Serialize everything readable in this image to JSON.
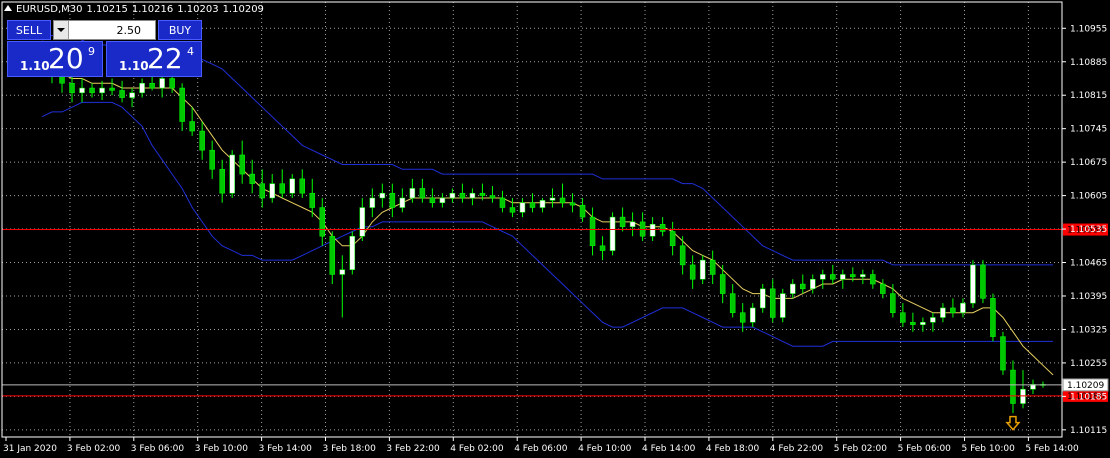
{
  "header": {
    "symbol": "EURUSD,M30",
    "open": "1.10215",
    "high": "1.10216",
    "low": "1.10203",
    "close": "1.10209"
  },
  "trade_panel": {
    "sell_label": "SELL",
    "buy_label": "BUY",
    "lot_value": "2.50",
    "sell_quote": {
      "prefix": "1.10",
      "big": "20",
      "pip": "9"
    },
    "buy_quote": {
      "prefix": "1.10",
      "big": "22",
      "pip": "4"
    }
  },
  "colors": {
    "background": "#000000",
    "grid": "#a0a0a0",
    "bull_candle": "#ffffff",
    "bear_candle": "#00c800",
    "wick": "#00ff00",
    "bollinger": "#1f2fd8",
    "moving_average": "#e8d060",
    "level_line": "#ff0000",
    "current_price_line": "#bbbbbb",
    "signal_arrow": "#e8a000"
  },
  "chart_data": {
    "type": "candlestick",
    "title": "",
    "y_ticks": [
      "1.10955",
      "1.10885",
      "1.10815",
      "1.10745",
      "1.10675",
      "1.10605",
      "1.10535",
      "1.10465",
      "1.10395",
      "1.10325",
      "1.10255",
      "1.10185",
      "1.10115"
    ],
    "x_ticks": [
      "31 Jan 2020",
      "3 Feb 02:00",
      "3 Feb 06:00",
      "3 Feb 10:00",
      "3 Feb 14:00",
      "3 Feb 18:00",
      "3 Feb 22:00",
      "4 Feb 02:00",
      "4 Feb 06:00",
      "4 Feb 10:00",
      "4 Feb 14:00",
      "4 Feb 18:00",
      "4 Feb 22:00",
      "5 Feb 02:00",
      "5 Feb 06:00",
      "5 Feb 10:00",
      "5 Feb 14:00"
    ],
    "ylim": [
      1.101,
      1.1101
    ],
    "horizontal_levels": [
      {
        "label": "1.10534",
        "value": 1.10534,
        "color": "#ff0000"
      },
      {
        "label": "1.10186",
        "value": 1.10186,
        "color": "#ff0000"
      },
      {
        "label": "1.10209",
        "value": 1.10209,
        "color": "#bbbbbb"
      }
    ],
    "candles": [
      {
        "o": 1.1089,
        "h": 1.109,
        "l": 1.1086,
        "c": 1.1088
      },
      {
        "o": 1.1088,
        "h": 1.1089,
        "l": 1.1084,
        "c": 1.1086
      },
      {
        "o": 1.1086,
        "h": 1.1088,
        "l": 1.1082,
        "c": 1.1084
      },
      {
        "o": 1.1084,
        "h": 1.1086,
        "l": 1.108,
        "c": 1.1082
      },
      {
        "o": 1.1082,
        "h": 1.1085,
        "l": 1.108,
        "c": 1.1083
      },
      {
        "o": 1.1083,
        "h": 1.1084,
        "l": 1.1081,
        "c": 1.1082
      },
      {
        "o": 1.1082,
        "h": 1.10845,
        "l": 1.10805,
        "c": 1.1083
      },
      {
        "o": 1.1083,
        "h": 1.1085,
        "l": 1.10815,
        "c": 1.10825
      },
      {
        "o": 1.10825,
        "h": 1.10845,
        "l": 1.108,
        "c": 1.1081
      },
      {
        "o": 1.1081,
        "h": 1.1083,
        "l": 1.1079,
        "c": 1.1082
      },
      {
        "o": 1.1082,
        "h": 1.1085,
        "l": 1.1081,
        "c": 1.1084
      },
      {
        "o": 1.1084,
        "h": 1.10855,
        "l": 1.10825,
        "c": 1.1083
      },
      {
        "o": 1.1083,
        "h": 1.1086,
        "l": 1.1081,
        "c": 1.1085
      },
      {
        "o": 1.1085,
        "h": 1.1086,
        "l": 1.1082,
        "c": 1.1083
      },
      {
        "o": 1.1083,
        "h": 1.1084,
        "l": 1.1074,
        "c": 1.1076
      },
      {
        "o": 1.1076,
        "h": 1.1079,
        "l": 1.1073,
        "c": 1.1074
      },
      {
        "o": 1.1074,
        "h": 1.1076,
        "l": 1.1068,
        "c": 1.107
      },
      {
        "o": 1.107,
        "h": 1.1072,
        "l": 1.1064,
        "c": 1.1066
      },
      {
        "o": 1.1066,
        "h": 1.1068,
        "l": 1.1059,
        "c": 1.1061
      },
      {
        "o": 1.1061,
        "h": 1.107,
        "l": 1.106,
        "c": 1.1069
      },
      {
        "o": 1.1069,
        "h": 1.1072,
        "l": 1.1063,
        "c": 1.1065
      },
      {
        "o": 1.1065,
        "h": 1.1068,
        "l": 1.1061,
        "c": 1.1063
      },
      {
        "o": 1.1063,
        "h": 1.1066,
        "l": 1.1058,
        "c": 1.106
      },
      {
        "o": 1.106,
        "h": 1.1065,
        "l": 1.1059,
        "c": 1.1063
      },
      {
        "o": 1.1063,
        "h": 1.1066,
        "l": 1.106,
        "c": 1.1061
      },
      {
        "o": 1.1061,
        "h": 1.1065,
        "l": 1.106,
        "c": 1.1064
      },
      {
        "o": 1.1064,
        "h": 1.1066,
        "l": 1.106,
        "c": 1.1061
      },
      {
        "o": 1.1061,
        "h": 1.1064,
        "l": 1.1056,
        "c": 1.1058
      },
      {
        "o": 1.1058,
        "h": 1.106,
        "l": 1.105,
        "c": 1.1052
      },
      {
        "o": 1.1052,
        "h": 1.1053,
        "l": 1.1042,
        "c": 1.1044
      },
      {
        "o": 1.1044,
        "h": 1.1048,
        "l": 1.1035,
        "c": 1.1045
      },
      {
        "o": 1.1045,
        "h": 1.1053,
        "l": 1.1044,
        "c": 1.1052
      },
      {
        "o": 1.1052,
        "h": 1.106,
        "l": 1.1051,
        "c": 1.1058
      },
      {
        "o": 1.1058,
        "h": 1.1062,
        "l": 1.1056,
        "c": 1.106
      },
      {
        "o": 1.106,
        "h": 1.1063,
        "l": 1.1058,
        "c": 1.1061
      },
      {
        "o": 1.1061,
        "h": 1.1063,
        "l": 1.1056,
        "c": 1.1058
      },
      {
        "o": 1.1058,
        "h": 1.1062,
        "l": 1.1057,
        "c": 1.106
      },
      {
        "o": 1.106,
        "h": 1.1064,
        "l": 1.1059,
        "c": 1.1062
      },
      {
        "o": 1.1062,
        "h": 1.1064,
        "l": 1.1059,
        "c": 1.106
      },
      {
        "o": 1.106,
        "h": 1.1062,
        "l": 1.1058,
        "c": 1.1059
      },
      {
        "o": 1.1059,
        "h": 1.1061,
        "l": 1.1058,
        "c": 1.106
      },
      {
        "o": 1.106,
        "h": 1.1062,
        "l": 1.1059,
        "c": 1.1061
      },
      {
        "o": 1.1061,
        "h": 1.1063,
        "l": 1.1059,
        "c": 1.106
      },
      {
        "o": 1.106,
        "h": 1.1062,
        "l": 1.10585,
        "c": 1.1061
      },
      {
        "o": 1.1061,
        "h": 1.1063,
        "l": 1.10595,
        "c": 1.10605
      },
      {
        "o": 1.10605,
        "h": 1.10625,
        "l": 1.1059,
        "c": 1.106
      },
      {
        "o": 1.106,
        "h": 1.10615,
        "l": 1.1057,
        "c": 1.1058
      },
      {
        "o": 1.1058,
        "h": 1.106,
        "l": 1.1056,
        "c": 1.1057
      },
      {
        "o": 1.1057,
        "h": 1.106,
        "l": 1.1056,
        "c": 1.1059
      },
      {
        "o": 1.1059,
        "h": 1.1061,
        "l": 1.1057,
        "c": 1.1058
      },
      {
        "o": 1.1058,
        "h": 1.106,
        "l": 1.1057,
        "c": 1.10595
      },
      {
        "o": 1.10595,
        "h": 1.1062,
        "l": 1.1058,
        "c": 1.106
      },
      {
        "o": 1.106,
        "h": 1.1063,
        "l": 1.1058,
        "c": 1.1059
      },
      {
        "o": 1.1059,
        "h": 1.1061,
        "l": 1.1057,
        "c": 1.10585
      },
      {
        "o": 1.10585,
        "h": 1.106,
        "l": 1.1055,
        "c": 1.1056
      },
      {
        "o": 1.1056,
        "h": 1.1058,
        "l": 1.1048,
        "c": 1.105
      },
      {
        "o": 1.105,
        "h": 1.1052,
        "l": 1.1047,
        "c": 1.1049
      },
      {
        "o": 1.1049,
        "h": 1.1057,
        "l": 1.1048,
        "c": 1.1056
      },
      {
        "o": 1.1056,
        "h": 1.1058,
        "l": 1.1053,
        "c": 1.1054
      },
      {
        "o": 1.1054,
        "h": 1.1057,
        "l": 1.1052,
        "c": 1.1055
      },
      {
        "o": 1.1055,
        "h": 1.1057,
        "l": 1.1051,
        "c": 1.1052
      },
      {
        "o": 1.1052,
        "h": 1.1056,
        "l": 1.1051,
        "c": 1.10545
      },
      {
        "o": 1.10545,
        "h": 1.1056,
        "l": 1.1052,
        "c": 1.1053
      },
      {
        "o": 1.1053,
        "h": 1.1055,
        "l": 1.1048,
        "c": 1.105
      },
      {
        "o": 1.105,
        "h": 1.1052,
        "l": 1.1044,
        "c": 1.1046
      },
      {
        "o": 1.1046,
        "h": 1.1048,
        "l": 1.1041,
        "c": 1.1043
      },
      {
        "o": 1.1043,
        "h": 1.1048,
        "l": 1.1042,
        "c": 1.1047
      },
      {
        "o": 1.1047,
        "h": 1.1049,
        "l": 1.1042,
        "c": 1.1044
      },
      {
        "o": 1.1044,
        "h": 1.1046,
        "l": 1.1038,
        "c": 1.104
      },
      {
        "o": 1.104,
        "h": 1.1042,
        "l": 1.1035,
        "c": 1.1036
      },
      {
        "o": 1.1036,
        "h": 1.1038,
        "l": 1.1032,
        "c": 1.1034
      },
      {
        "o": 1.1034,
        "h": 1.1038,
        "l": 1.1033,
        "c": 1.1037
      },
      {
        "o": 1.1037,
        "h": 1.1042,
        "l": 1.1036,
        "c": 1.1041
      },
      {
        "o": 1.1041,
        "h": 1.1043,
        "l": 1.1034,
        "c": 1.1035
      },
      {
        "o": 1.1035,
        "h": 1.1041,
        "l": 1.1034,
        "c": 1.104
      },
      {
        "o": 1.104,
        "h": 1.1043,
        "l": 1.1039,
        "c": 1.1042
      },
      {
        "o": 1.1042,
        "h": 1.1044,
        "l": 1.104,
        "c": 1.1041
      },
      {
        "o": 1.1041,
        "h": 1.1044,
        "l": 1.104,
        "c": 1.1043
      },
      {
        "o": 1.1043,
        "h": 1.1045,
        "l": 1.1041,
        "c": 1.1044
      },
      {
        "o": 1.1044,
        "h": 1.1046,
        "l": 1.1042,
        "c": 1.1043
      },
      {
        "o": 1.1043,
        "h": 1.1045,
        "l": 1.1041,
        "c": 1.1044
      },
      {
        "o": 1.1044,
        "h": 1.10455,
        "l": 1.10425,
        "c": 1.10435
      },
      {
        "o": 1.10435,
        "h": 1.1045,
        "l": 1.1042,
        "c": 1.1044
      },
      {
        "o": 1.1044,
        "h": 1.1045,
        "l": 1.1041,
        "c": 1.1042
      },
      {
        "o": 1.1042,
        "h": 1.1043,
        "l": 1.1039,
        "c": 1.104
      },
      {
        "o": 1.104,
        "h": 1.1042,
        "l": 1.1035,
        "c": 1.1036
      },
      {
        "o": 1.1036,
        "h": 1.1038,
        "l": 1.1033,
        "c": 1.1034
      },
      {
        "o": 1.1034,
        "h": 1.1036,
        "l": 1.1032,
        "c": 1.10335
      },
      {
        "o": 1.10335,
        "h": 1.1035,
        "l": 1.1032,
        "c": 1.1034
      },
      {
        "o": 1.1034,
        "h": 1.1036,
        "l": 1.1032,
        "c": 1.1035
      },
      {
        "o": 1.1035,
        "h": 1.1038,
        "l": 1.1034,
        "c": 1.1037
      },
      {
        "o": 1.1037,
        "h": 1.1039,
        "l": 1.1035,
        "c": 1.1036
      },
      {
        "o": 1.1036,
        "h": 1.1039,
        "l": 1.1035,
        "c": 1.1038
      },
      {
        "o": 1.1038,
        "h": 1.1047,
        "l": 1.1037,
        "c": 1.1046
      },
      {
        "o": 1.1046,
        "h": 1.1047,
        "l": 1.1038,
        "c": 1.1039
      },
      {
        "o": 1.1039,
        "h": 1.104,
        "l": 1.103,
        "c": 1.1031
      },
      {
        "o": 1.1031,
        "h": 1.1032,
        "l": 1.1023,
        "c": 1.1024
      },
      {
        "o": 1.1024,
        "h": 1.1026,
        "l": 1.1015,
        "c": 1.1017
      },
      {
        "o": 1.1017,
        "h": 1.1024,
        "l": 1.1016,
        "c": 1.102
      },
      {
        "o": 1.102,
        "h": 1.1022,
        "l": 1.1019,
        "c": 1.1021
      },
      {
        "o": 1.1021,
        "h": 1.10216,
        "l": 1.10203,
        "c": 1.10209
      }
    ],
    "moving_average": [
      1.1087,
      1.1087,
      1.1086,
      1.1085,
      1.1085,
      1.1084,
      1.1084,
      1.1084,
      1.1083,
      1.1083,
      1.1083,
      1.1083,
      1.1083,
      1.1083,
      1.1081,
      1.1079,
      1.1076,
      1.1073,
      1.107,
      1.1068,
      1.1066,
      1.1064,
      1.1062,
      1.1061,
      1.106,
      1.1059,
      1.1058,
      1.1057,
      1.1055,
      1.1052,
      1.105,
      1.105,
      1.1052,
      1.1055,
      1.1057,
      1.1058,
      1.1059,
      1.106,
      1.106,
      1.106,
      1.106,
      1.106,
      1.106,
      1.106,
      1.106,
      1.106,
      1.106,
      1.1059,
      1.1059,
      1.1059,
      1.1059,
      1.1059,
      1.1059,
      1.1059,
      1.1058,
      1.1056,
      1.1055,
      1.1055,
      1.1055,
      1.1055,
      1.1054,
      1.1054,
      1.1054,
      1.1053,
      1.1051,
      1.1049,
      1.1048,
      1.1047,
      1.1045,
      1.1043,
      1.1041,
      1.104,
      1.104,
      1.1039,
      1.1039,
      1.1039,
      1.104,
      1.1041,
      1.1042,
      1.1042,
      1.1043,
      1.1043,
      1.1043,
      1.1043,
      1.1042,
      1.1041,
      1.1039,
      1.1038,
      1.1037,
      1.1036,
      1.1036,
      1.1036,
      1.1036,
      1.1036,
      1.1037,
      1.1037,
      1.1035,
      1.1032,
      1.1029,
      1.1027,
      1.1025,
      1.1023
    ],
    "bollinger_upper": [
      1.1093,
      1.1094,
      1.1094,
      1.1094,
      1.1093,
      1.1092,
      1.1092,
      1.1092,
      1.1091,
      1.1091,
      1.109,
      1.109,
      1.109,
      1.109,
      1.109,
      1.109,
      1.1089,
      1.1088,
      1.1087,
      1.1085,
      1.1083,
      1.1081,
      1.1079,
      1.1077,
      1.1075,
      1.1073,
      1.1071,
      1.107,
      1.1069,
      1.1068,
      1.1067,
      1.1067,
      1.1067,
      1.1067,
      1.1067,
      1.1067,
      1.1066,
      1.1066,
      1.1066,
      1.1066,
      1.1065,
      1.1065,
      1.1065,
      1.1065,
      1.1065,
      1.1065,
      1.1065,
      1.1065,
      1.1065,
      1.1065,
      1.1065,
      1.1065,
      1.1065,
      1.1065,
      1.1065,
      1.1065,
      1.1064,
      1.1064,
      1.1064,
      1.1064,
      1.1064,
      1.1064,
      1.1064,
      1.1064,
      1.1063,
      1.1063,
      1.1062,
      1.106,
      1.1058,
      1.1056,
      1.1054,
      1.1052,
      1.105,
      1.1049,
      1.1048,
      1.1047,
      1.1047,
      1.1047,
      1.1047,
      1.1047,
      1.1047,
      1.1047,
      1.1047,
      1.1047,
      1.1047,
      1.1046,
      1.1046,
      1.1046,
      1.1046,
      1.1046,
      1.1046,
      1.1046,
      1.1046,
      1.1046,
      1.1046,
      1.1046,
      1.1046,
      1.1046,
      1.1046,
      1.1046,
      1.1046,
      1.1046
    ],
    "bollinger_lower": [
      1.1077,
      1.1078,
      1.1078,
      1.1079,
      1.108,
      1.108,
      1.108,
      1.108,
      1.1079,
      1.1077,
      1.1075,
      1.1071,
      1.1068,
      1.1065,
      1.1062,
      1.1058,
      1.1055,
      1.1052,
      1.105,
      1.1049,
      1.1048,
      1.1048,
      1.1047,
      1.1047,
      1.1047,
      1.1047,
      1.1048,
      1.1049,
      1.105,
      1.1051,
      1.1052,
      1.1053,
      1.1054,
      1.1054,
      1.1055,
      1.1055,
      1.1055,
      1.1055,
      1.1055,
      1.1055,
      1.1055,
      1.1055,
      1.1055,
      1.1055,
      1.1055,
      1.1054,
      1.1053,
      1.1052,
      1.105,
      1.1048,
      1.1046,
      1.1044,
      1.1042,
      1.104,
      1.1038,
      1.1036,
      1.1034,
      1.1033,
      1.1033,
      1.1034,
      1.1035,
      1.1036,
      1.1037,
      1.1037,
      1.1037,
      1.1036,
      1.1035,
      1.1034,
      1.1033,
      1.1033,
      1.1033,
      1.1033,
      1.1032,
      1.1031,
      1.103,
      1.1029,
      1.1029,
      1.1029,
      1.1029,
      1.103,
      1.103,
      1.103,
      1.103,
      1.103,
      1.103,
      1.103,
      1.103,
      1.103,
      1.103,
      1.103,
      1.103,
      1.103,
      1.103,
      1.103,
      1.103,
      1.103,
      1.103,
      1.103,
      1.103,
      1.103,
      1.103,
      1.103
    ]
  }
}
